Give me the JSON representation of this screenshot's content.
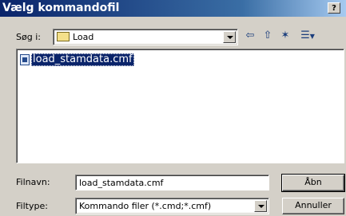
{
  "window": {
    "title": "Vælg kommandofil",
    "help_button": "?"
  },
  "lookin": {
    "label": "Søg i:",
    "value": "Load"
  },
  "toolbar": {
    "back_glyph": "⇦",
    "up_glyph": "⇧",
    "new_folder_glyph": "✶",
    "view_glyph": "☰"
  },
  "files": [
    {
      "name": "load_stamdata.cmf"
    }
  ],
  "filename": {
    "label": "Filnavn:",
    "value": "load_stamdata.cmf"
  },
  "filetype": {
    "label": "Filtype:",
    "value": "Kommando filer (*.cmd;*.cmf)"
  },
  "buttons": {
    "open": "Åbn",
    "cancel": "Annuller"
  },
  "colors": {
    "title_bar": "#0a246a",
    "selection": "#0a246a",
    "face": "#d4d0c8"
  }
}
